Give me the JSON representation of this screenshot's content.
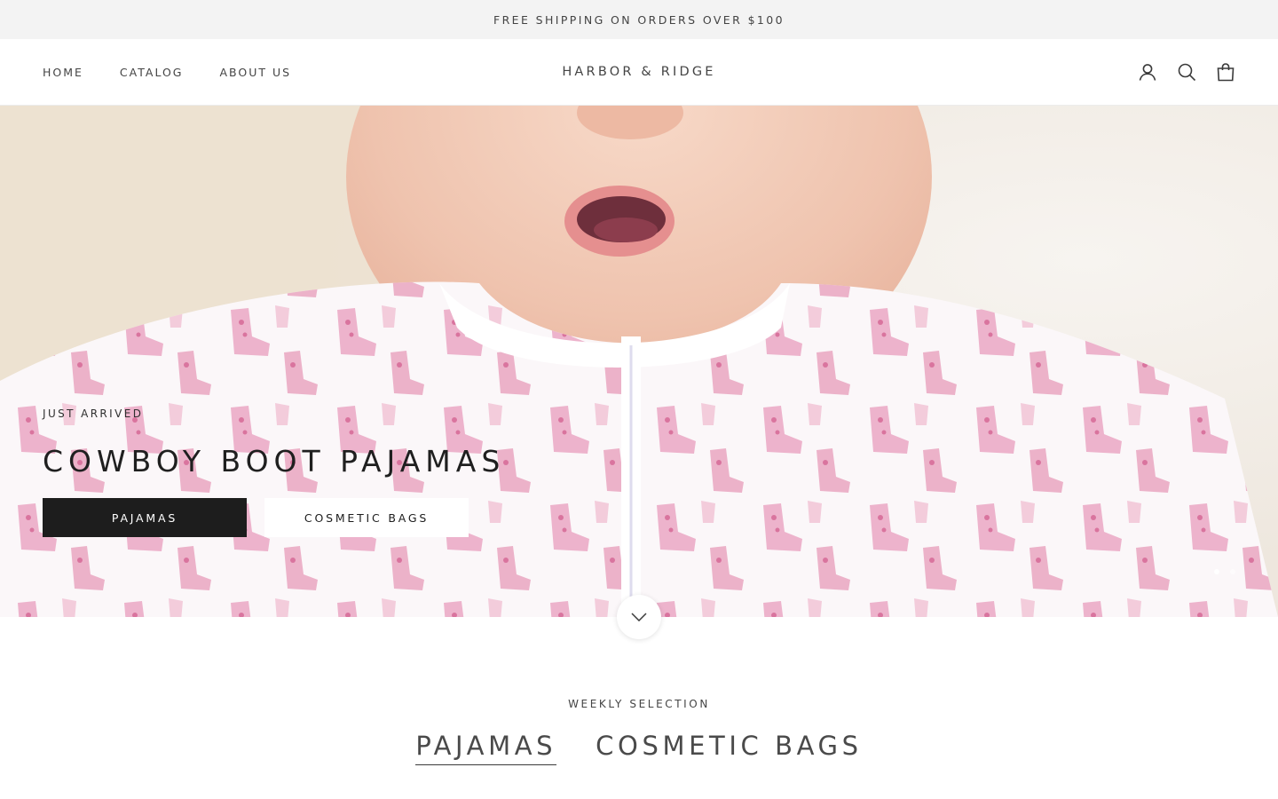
{
  "announcement": {
    "text": "FREE SHIPPING ON ORDERS OVER $100"
  },
  "header": {
    "nav": [
      {
        "label": "HOME"
      },
      {
        "label": "CATALOG"
      },
      {
        "label": "ABOUT US"
      }
    ],
    "logo": "HARBOR & RIDGE",
    "icons": [
      "account-icon",
      "search-icon",
      "cart-icon"
    ]
  },
  "hero": {
    "subheading": "JUST ARRIVED",
    "title": "COWBOY BOOT PAJAMAS",
    "buttons": [
      {
        "label": "PAJAMAS",
        "style": "dark"
      },
      {
        "label": "COSMETIC BAGS",
        "style": "light"
      }
    ],
    "slide_count": 2,
    "active_slide": 1
  },
  "collection": {
    "subheading": "WEEKLY SELECTION",
    "tabs": [
      {
        "label": "PAJAMAS",
        "active": true
      },
      {
        "label": "COSMETIC BAGS",
        "active": false
      }
    ]
  },
  "colors": {
    "announcement_bg": "#f3f3f3",
    "button_dark": "#1d1d1d",
    "boot_pink": "#eaa3c0"
  }
}
